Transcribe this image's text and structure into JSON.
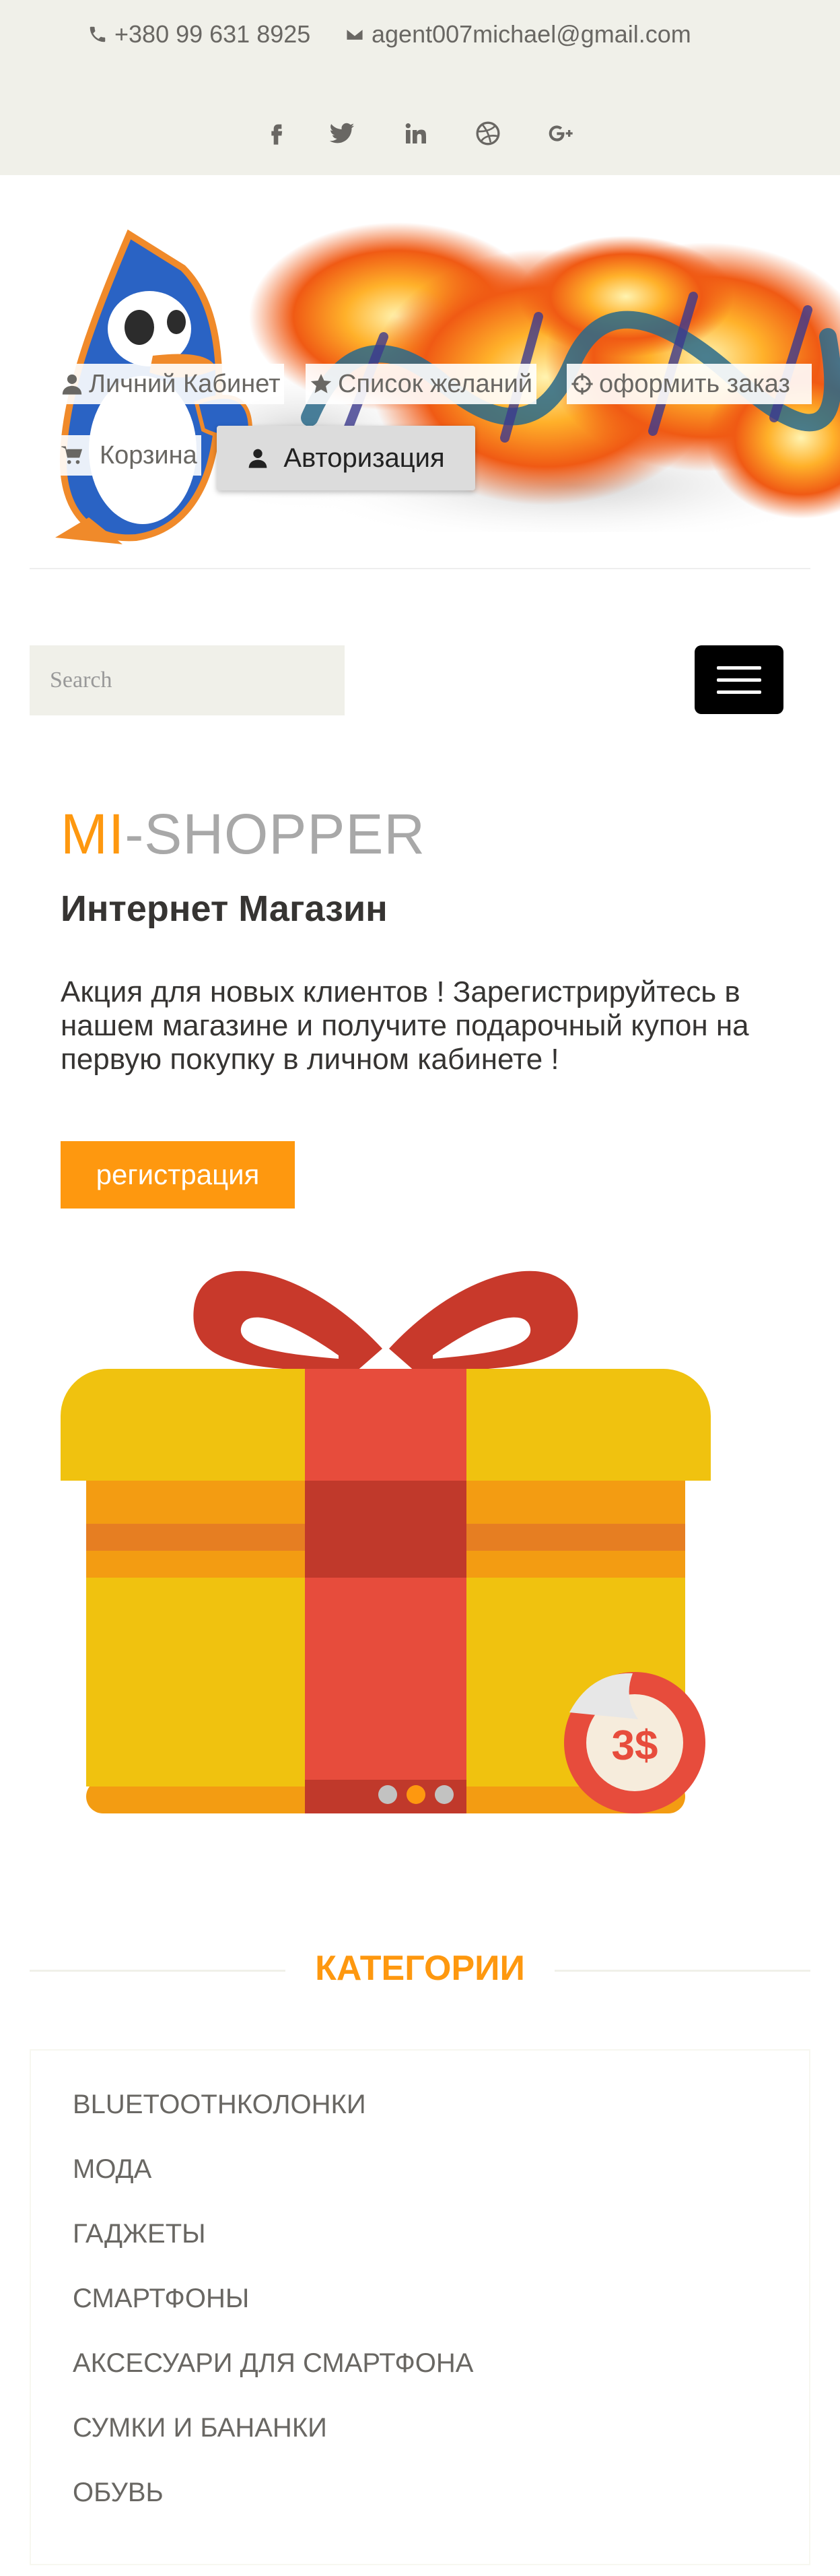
{
  "header_top": {
    "phone": "+380 99 631 8925",
    "email": "agent007michael@gmail.com",
    "social": [
      "facebook-icon",
      "twitter-icon",
      "linkedin-icon",
      "dribbble-icon",
      "google-plus-icon"
    ]
  },
  "header_menu": {
    "account": "Личний Кабинет",
    "wishlist": "Список желаний",
    "checkout": "оформить заказ",
    "cart": "Корзина",
    "login": "Авторизация"
  },
  "search": {
    "placeholder": "Search"
  },
  "slider": {
    "brand_accent": "MI",
    "brand_rest": "-SHOPPER",
    "subtitle": "Интернет Магазин",
    "text": "Акция для новых клиентов ! Зарегистрируйтесь в нашем магазине и получите подарочный купон на первую покупку в личном кабинете !",
    "button": "регистрация",
    "badge": "3$",
    "active_slide": 2,
    "slide_count": 3
  },
  "categories": {
    "title": "КАТЕГОРИИ",
    "items": [
      "BLUETOOTНКОЛОНКИ",
      "МОДА",
      "ГАДЖЕТЫ",
      "СМАРТФОНЫ",
      "АКСЕСУАРИ ДЛЯ СМАРТФОНА",
      "СУМКИ И БАНАНКИ",
      "ОБУВЬ"
    ]
  },
  "colors": {
    "accent": "#fe980f",
    "topbar_bg": "#f0f0e9",
    "text_muted": "#696763"
  }
}
